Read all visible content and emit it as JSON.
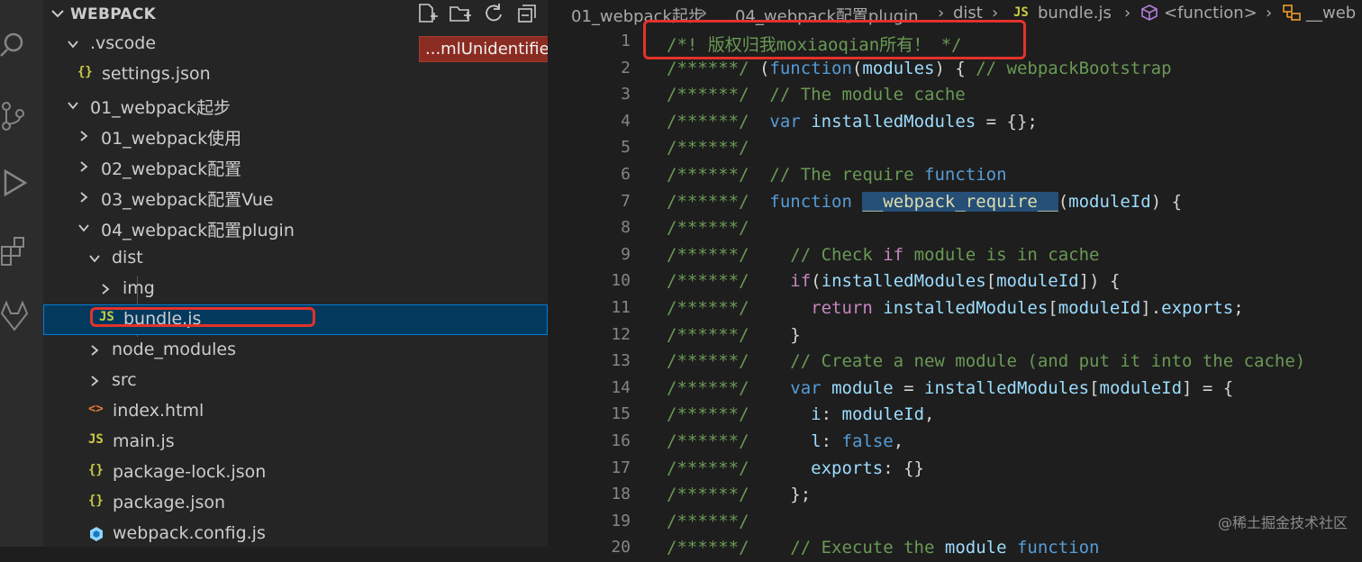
{
  "explorer": {
    "title": "WEBPACK",
    "tooltip": "...mlUnidentifie<te",
    "items": [
      {
        "label": ".vscode",
        "type": "folder",
        "expanded": true
      },
      {
        "label": "settings.json",
        "type": "json",
        "icon": "{}"
      },
      {
        "label": "01_webpack起步",
        "type": "folder",
        "expanded": true
      },
      {
        "label": "01_webpack使用",
        "type": "folder",
        "expanded": false
      },
      {
        "label": "02_webpack配置",
        "type": "folder",
        "expanded": false
      },
      {
        "label": "03_webpack配置Vue",
        "type": "folder",
        "expanded": false
      },
      {
        "label": "04_webpack配置plugin",
        "type": "folder",
        "expanded": true
      },
      {
        "label": "dist",
        "type": "folder",
        "expanded": true
      },
      {
        "label": "img",
        "type": "folder",
        "expanded": false
      },
      {
        "label": "bundle.js",
        "type": "js",
        "icon": "JS",
        "selected": true
      },
      {
        "label": "node_modules",
        "type": "folder",
        "expanded": false
      },
      {
        "label": "src",
        "type": "folder",
        "expanded": false
      },
      {
        "label": "index.html",
        "type": "html",
        "icon": "<>"
      },
      {
        "label": "main.js",
        "type": "js",
        "icon": "JS"
      },
      {
        "label": "package-lock.json",
        "type": "json",
        "icon": "{}"
      },
      {
        "label": "package.json",
        "type": "json",
        "icon": "{}"
      },
      {
        "label": "webpack.config.js",
        "type": "webpack",
        "icon": "webpack-icon"
      }
    ]
  },
  "breadcrumb": {
    "parts": [
      "01_webpack起步",
      "04_webpack配置plugin",
      "dist",
      "bundle.js",
      "<function>",
      "__web"
    ],
    "js_badge": "JS"
  },
  "editor": {
    "lines": [
      {
        "n": "1",
        "text": "/*! 版权归我moxiaoqian所有！ */"
      },
      {
        "n": "2",
        "text": "/******/ (function(modules) { // webpackBootstrap"
      },
      {
        "n": "3",
        "text": "/******/  // The module cache"
      },
      {
        "n": "4",
        "text": "/******/  var installedModules = {};"
      },
      {
        "n": "5",
        "text": "/******/"
      },
      {
        "n": "6",
        "text": "/******/  // The require function"
      },
      {
        "n": "7",
        "text": "/******/  function __webpack_require__(moduleId) {"
      },
      {
        "n": "8",
        "text": "/******/"
      },
      {
        "n": "9",
        "text": "/******/    // Check if module is in cache"
      },
      {
        "n": "10",
        "text": "/******/    if(installedModules[moduleId]) {"
      },
      {
        "n": "11",
        "text": "/******/      return installedModules[moduleId].exports;"
      },
      {
        "n": "12",
        "text": "/******/    }"
      },
      {
        "n": "13",
        "text": "/******/    // Create a new module (and put it into the cache)"
      },
      {
        "n": "14",
        "text": "/******/    var module = installedModules[moduleId] = {"
      },
      {
        "n": "15",
        "text": "/******/      i: moduleId,"
      },
      {
        "n": "16",
        "text": "/******/      l: false,"
      },
      {
        "n": "17",
        "text": "/******/      exports: {}"
      },
      {
        "n": "18",
        "text": "/******/    };"
      },
      {
        "n": "19",
        "text": "/******/"
      },
      {
        "n": "20",
        "text": "/******/    // Execute the module function"
      }
    ]
  },
  "watermark": "@稀土掘金技术社区",
  "colors": {
    "accent_red": "#e3322b",
    "selection": "#04395e",
    "comment": "#6a9955",
    "keyword": "#569cd6"
  }
}
